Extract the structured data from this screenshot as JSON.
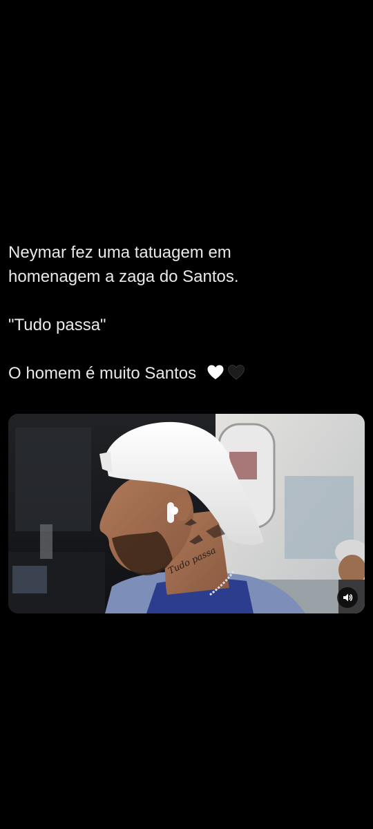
{
  "post": {
    "line1": "Neymar fez uma tatuagem em",
    "line2": "homenagem a zaga do Santos.",
    "line3": "\"Tudo passa\"",
    "line4": "O homem é muito Santos",
    "emojis": [
      "white-heart",
      "black-heart"
    ]
  },
  "media": {
    "type": "video",
    "tattoo_text": "Tudo passa",
    "volume_icon": "speaker-icon"
  },
  "colors": {
    "background": "#000000",
    "text": "#e7e9ea",
    "cap": "#f2f2f2",
    "shirt": "#2b3d8c"
  }
}
